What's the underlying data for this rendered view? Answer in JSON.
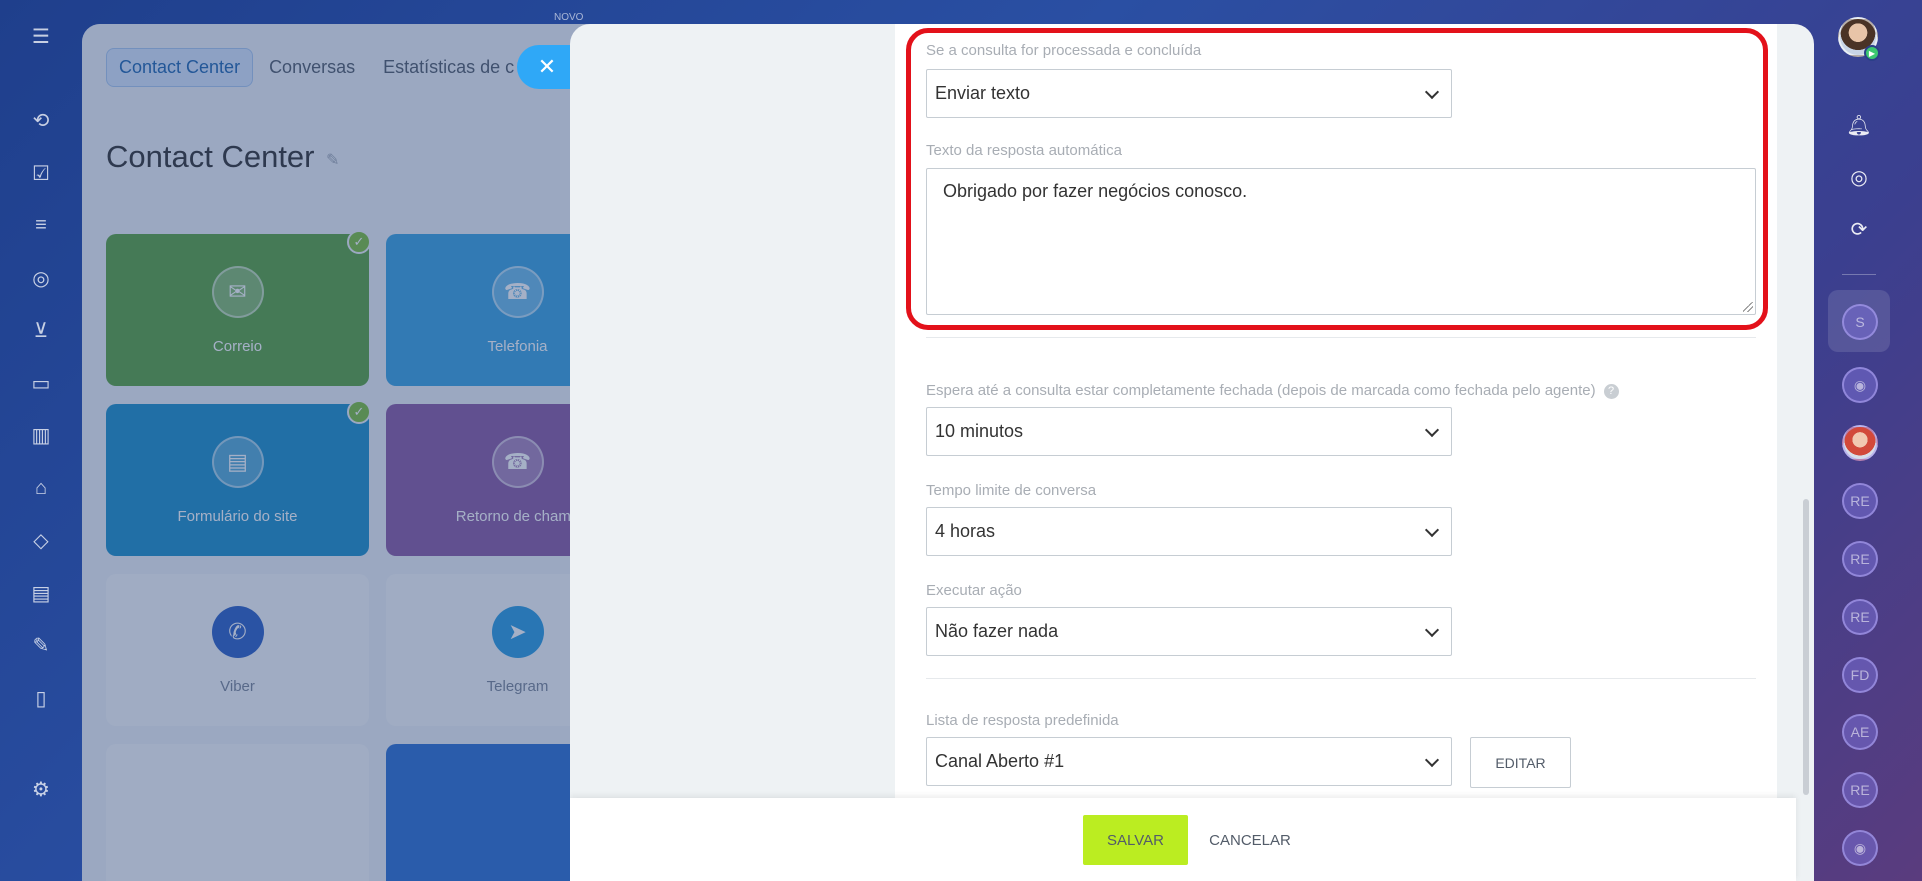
{
  "background_app": {
    "novo_label": "NOVO",
    "tabs": [
      {
        "label": "Contact Center"
      },
      {
        "label": "Conversas"
      },
      {
        "label": "Estatísticas de c"
      }
    ],
    "title": "Contact Center",
    "tiles": [
      {
        "label": "Correio",
        "icon": "mail-icon"
      },
      {
        "label": "Telefonia",
        "icon": "phone-icon"
      },
      {
        "label": "Formulário do site",
        "icon": "form-icon"
      },
      {
        "label": "Retorno de chama",
        "icon": "callback-icon"
      },
      {
        "label": "Viber",
        "icon": "viber-icon"
      },
      {
        "label": "Telegram",
        "icon": "telegram-icon"
      }
    ]
  },
  "close_icon": "✕",
  "form": {
    "completed_label": "Se a consulta for processada e concluída",
    "completed_value": "Enviar texto",
    "autoreply_label": "Texto da resposta automática",
    "autoreply_text": "Obrigado por fazer negócios conosco.",
    "wait_label": "Espera até a consulta estar completamente fechada (depois de marcada como fechada pelo agente)",
    "wait_value": "10 minutos",
    "timeout_label": "Tempo limite de conversa",
    "timeout_value": "4 horas",
    "action_label": "Executar ação",
    "action_value": "Não fazer nada",
    "predefined_label": "Lista de resposta predefinida",
    "predefined_value": "Canal Aberto #1",
    "edit_label": "EDITAR"
  },
  "footer": {
    "save_label": "SALVAR",
    "cancel_label": "CANCELAR"
  },
  "right_sidebar": {
    "circles": [
      "S",
      "",
      "",
      "RE",
      "RE",
      "RE",
      "FD",
      "AE",
      "RE",
      ""
    ]
  },
  "colors": {
    "highlight": "#e3111a",
    "save_button": "#bbed21",
    "close_button": "#2fa8f7"
  }
}
